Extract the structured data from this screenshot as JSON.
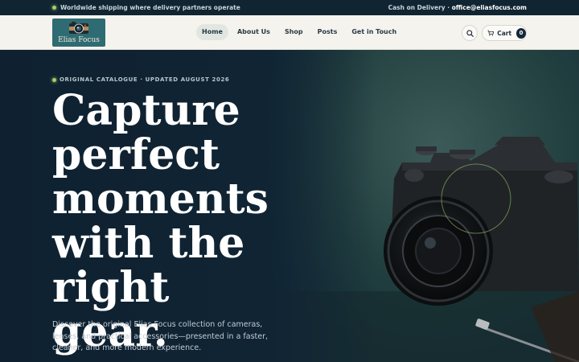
{
  "topbar": {
    "shipping_text": "Worldwide shipping where delivery partners operate",
    "cod_text": "Cash on Delivery · ",
    "email": "office@eliasfocus.com"
  },
  "brand": {
    "name": "Elias Focus"
  },
  "nav": {
    "items": [
      {
        "label": "Home",
        "active": true
      },
      {
        "label": "About Us"
      },
      {
        "label": "Shop"
      },
      {
        "label": "Posts"
      },
      {
        "label": "Get in Touch"
      }
    ]
  },
  "header_actions": {
    "search_icon": "search-icon",
    "cart_label": "Cart",
    "cart_count": "0"
  },
  "hero": {
    "eyebrow": "ORIGINAL CATALOGUE · UPDATED AUGUST 2026",
    "headline_lines": [
      "Capture",
      "perfect",
      "moments",
      "with the",
      "right gear."
    ],
    "description": "Discover the original Elias Focus collection of cameras, lenses, and practical accessories—presented in a faster, cleaner, and more modern experience."
  },
  "colors": {
    "accent_dot": "#a6cf6a",
    "dark_bg": "#0f2231",
    "header_bg": "#f5f3ee"
  }
}
